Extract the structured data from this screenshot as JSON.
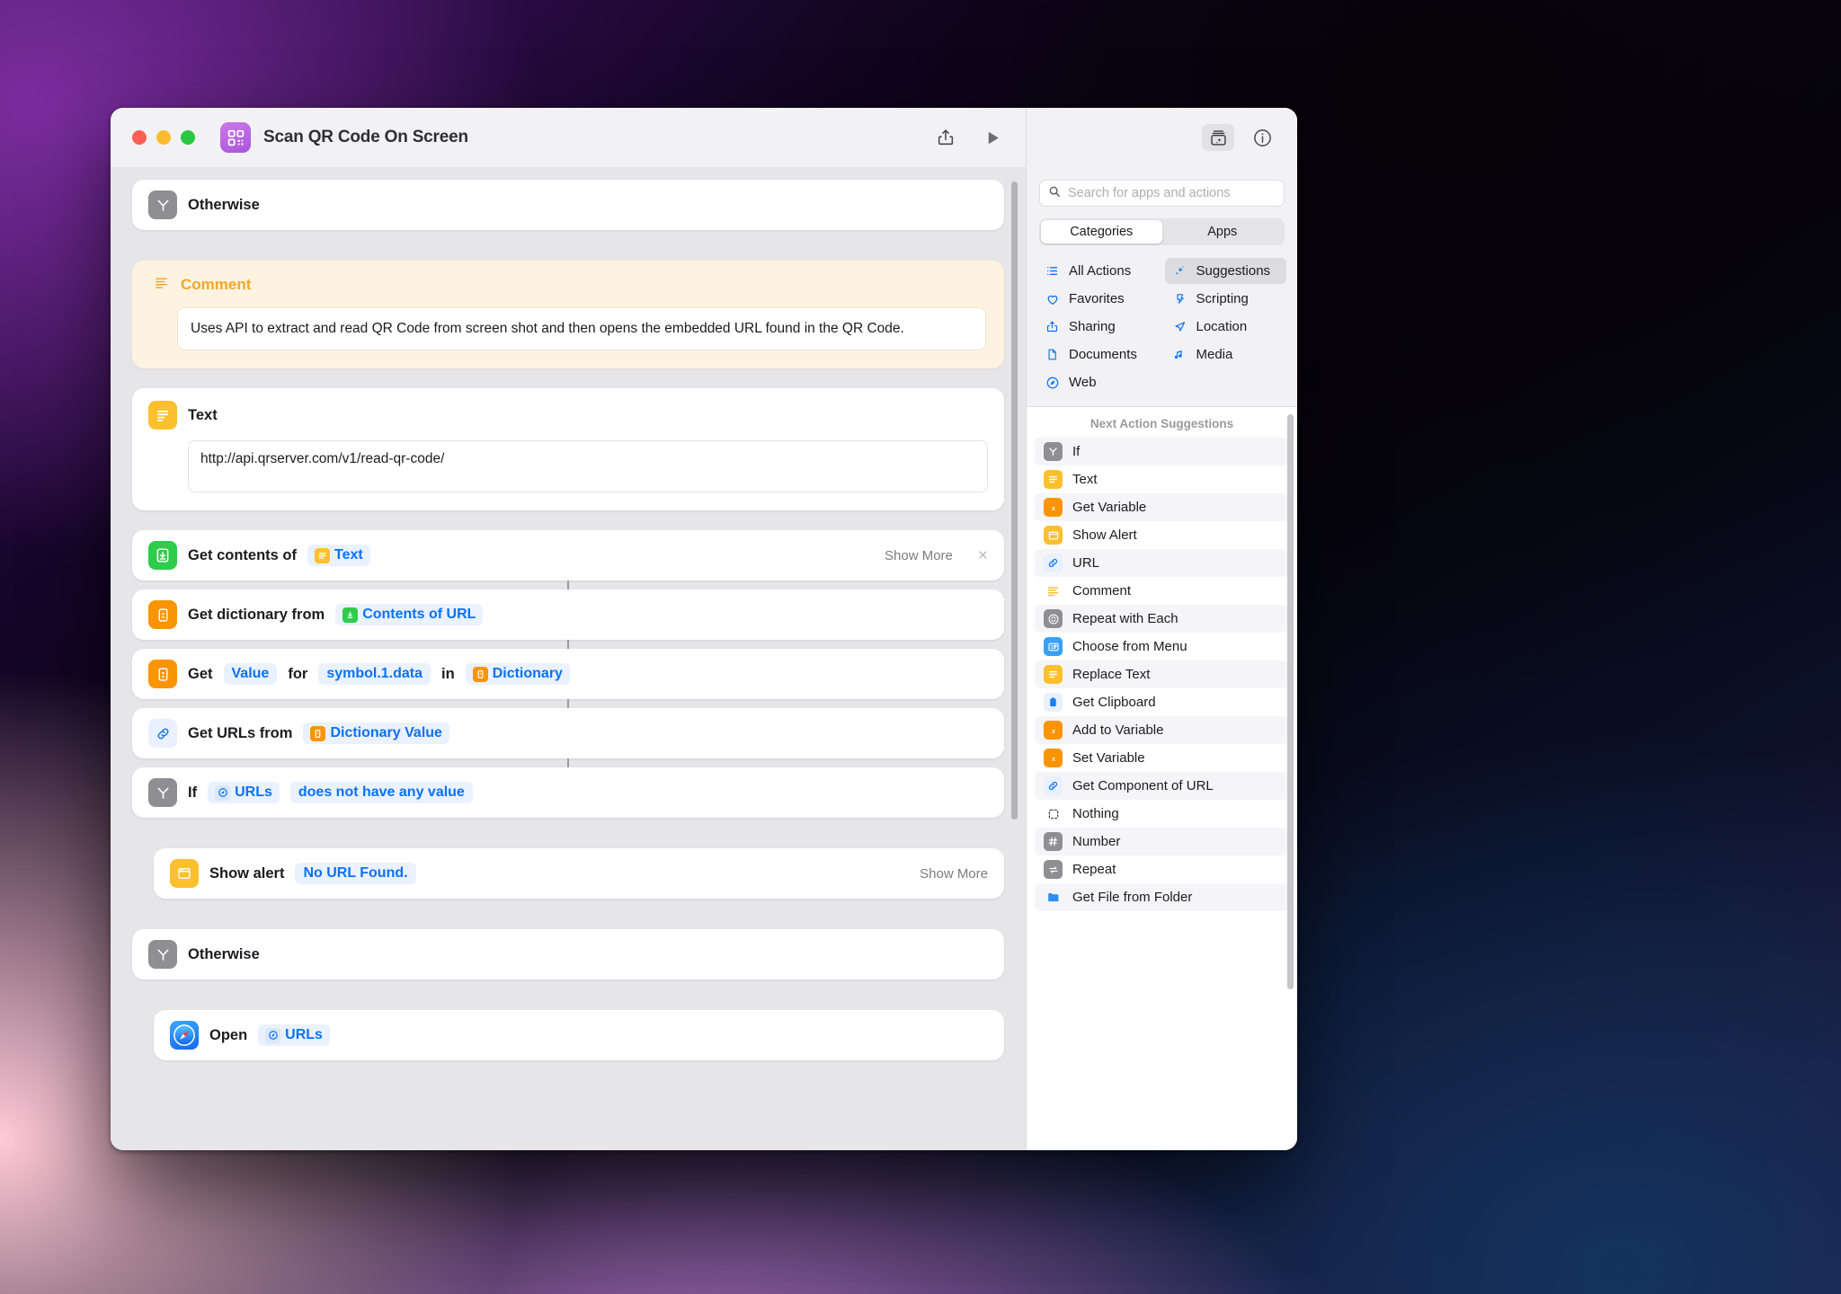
{
  "window": {
    "title": "Scan QR Code On Screen",
    "app_icon": "qr-code-icon",
    "traffic_lights": [
      "close",
      "minimize",
      "zoom"
    ],
    "toolbar": {
      "share_label": "share-icon",
      "run_label": "play-icon",
      "add_action_label": "action-library-icon",
      "info_label": "info-icon"
    }
  },
  "editor": {
    "rows": [
      {
        "id": "otherwise-top",
        "type": "action",
        "icon": "if-icon",
        "icon_color": "gray",
        "label": "Otherwise"
      },
      {
        "id": "comment",
        "type": "comment",
        "icon": "comment-lines-icon",
        "title": "Comment",
        "body": "Uses API to extract and read QR Code from screen shot and then opens the embedded URL found in the QR Code."
      },
      {
        "id": "text",
        "type": "text-action",
        "icon": "text-icon",
        "icon_color": "yellow",
        "label": "Text",
        "value": "http://api.qrserver.com/v1/read-qr-code/"
      },
      {
        "id": "get-contents-of-url",
        "type": "action",
        "icon": "download-icon",
        "icon_color": "green",
        "label": "Get contents of",
        "token": "Text",
        "token_icon": "text-icon",
        "token_icon_color": "yellow",
        "show_more": "Show More",
        "close": "×"
      },
      {
        "id": "get-dictionary-from",
        "type": "action",
        "icon": "dictionary-icon",
        "icon_color": "orange",
        "label": "Get dictionary from",
        "token": "Contents of URL",
        "token_icon": "download-icon",
        "token_icon_color": "green"
      },
      {
        "id": "get-value-for-key",
        "type": "action",
        "icon": "dictionary-icon",
        "icon_color": "orange",
        "label": "Get",
        "token": "Value",
        "label2": "for",
        "token2": "symbol.1.data",
        "label3": "in",
        "token3": "Dictionary",
        "token3_icon": "dictionary-icon",
        "token3_icon_color": "orange"
      },
      {
        "id": "get-urls-from",
        "type": "action",
        "icon": "link-icon",
        "icon_color": "blue-o",
        "label": "Get URLs from",
        "token": "Dictionary Value",
        "token_icon": "dictionary-icon",
        "token_icon_color": "orange"
      },
      {
        "id": "if",
        "type": "action",
        "icon": "if-icon",
        "icon_color": "gray",
        "label": "If",
        "token": "URLs",
        "token_icon": "compass-icon",
        "token_icon_color": "blue-o",
        "token2": "does not have any value"
      },
      {
        "id": "show-alert",
        "type": "action-indent",
        "icon": "alert-window-icon",
        "icon_color": "yellow",
        "label": "Show alert",
        "token": "No URL Found.",
        "show_more": "Show More"
      },
      {
        "id": "otherwise-bottom",
        "type": "action",
        "icon": "if-icon",
        "icon_color": "gray",
        "label": "Otherwise"
      },
      {
        "id": "open-urls",
        "type": "action-indent",
        "icon": "safari-icon",
        "icon_color": "safari",
        "label": "Open",
        "token": "URLs",
        "token_icon": "compass-icon",
        "token_icon_color": "blue-o"
      }
    ]
  },
  "sidebar": {
    "search": {
      "placeholder": "Search for apps and actions",
      "value": "",
      "icon": "search-icon"
    },
    "segments": [
      {
        "label": "Categories",
        "active": true
      },
      {
        "label": "Apps",
        "active": false
      }
    ],
    "categories": [
      {
        "label": "All Actions",
        "icon": "list-bullet-icon",
        "selected": false
      },
      {
        "label": "Suggestions",
        "icon": "sparkles-icon",
        "selected": true
      },
      {
        "label": "Favorites",
        "icon": "heart-icon",
        "selected": false
      },
      {
        "label": "Scripting",
        "icon": "scroll-icon",
        "selected": false
      },
      {
        "label": "Sharing",
        "icon": "share-icon",
        "selected": false
      },
      {
        "label": "Location",
        "icon": "paper-plane-icon",
        "selected": false
      },
      {
        "label": "Documents",
        "icon": "document-icon",
        "selected": false
      },
      {
        "label": "Media",
        "icon": "music-note-icon",
        "selected": false
      },
      {
        "label": "Web",
        "icon": "compass-icon",
        "selected": false
      }
    ],
    "suggestions_title": "Next Action Suggestions",
    "suggestions": [
      {
        "label": "If",
        "icon": "if-icon",
        "icon_color": "gray",
        "alt": true
      },
      {
        "label": "Text",
        "icon": "text-icon",
        "icon_color": "yellow",
        "alt": false
      },
      {
        "label": "Get Variable",
        "icon": "variable-x-icon",
        "icon_color": "orange",
        "alt": true
      },
      {
        "label": "Show Alert",
        "icon": "alert-window-icon",
        "icon_color": "yellow",
        "alt": false
      },
      {
        "label": "URL",
        "icon": "link-icon",
        "icon_color": "lblue",
        "alt": true
      },
      {
        "label": "Comment",
        "icon": "comment-lines-icon",
        "icon_color": "none",
        "alt": false
      },
      {
        "label": "Repeat with Each",
        "icon": "repeat-each-icon",
        "icon_color": "gray",
        "alt": true
      },
      {
        "label": "Choose from Menu",
        "icon": "menu-card-icon",
        "icon_color": "blue",
        "alt": false
      },
      {
        "label": "Replace Text",
        "icon": "text-icon",
        "icon_color": "yellow",
        "alt": true
      },
      {
        "label": "Get Clipboard",
        "icon": "clipboard-icon",
        "icon_color": "lblue",
        "alt": false
      },
      {
        "label": "Add to Variable",
        "icon": "variable-x-icon",
        "icon_color": "orange",
        "alt": true
      },
      {
        "label": "Set Variable",
        "icon": "variable-x-icon",
        "icon_color": "orange",
        "alt": false
      },
      {
        "label": "Get Component of URL",
        "icon": "link-icon",
        "icon_color": "lblue",
        "alt": true
      },
      {
        "label": "Nothing",
        "icon": "dashed-square-icon",
        "icon_color": "none",
        "alt": false
      },
      {
        "label": "Number",
        "icon": "hash-icon",
        "icon_color": "gray",
        "alt": true
      },
      {
        "label": "Repeat",
        "icon": "repeat-icon",
        "icon_color": "gray",
        "alt": false
      },
      {
        "label": "Get File from Folder",
        "icon": "folder-icon",
        "icon_color": "blue",
        "alt": true
      }
    ]
  },
  "colors": {
    "accent_blue": "#0a72f5",
    "yellow": "#fcc02e",
    "orange": "#f99500",
    "green": "#2ecc4a",
    "gray": "#8e8e93",
    "comment_yellow": "#f5a623"
  }
}
